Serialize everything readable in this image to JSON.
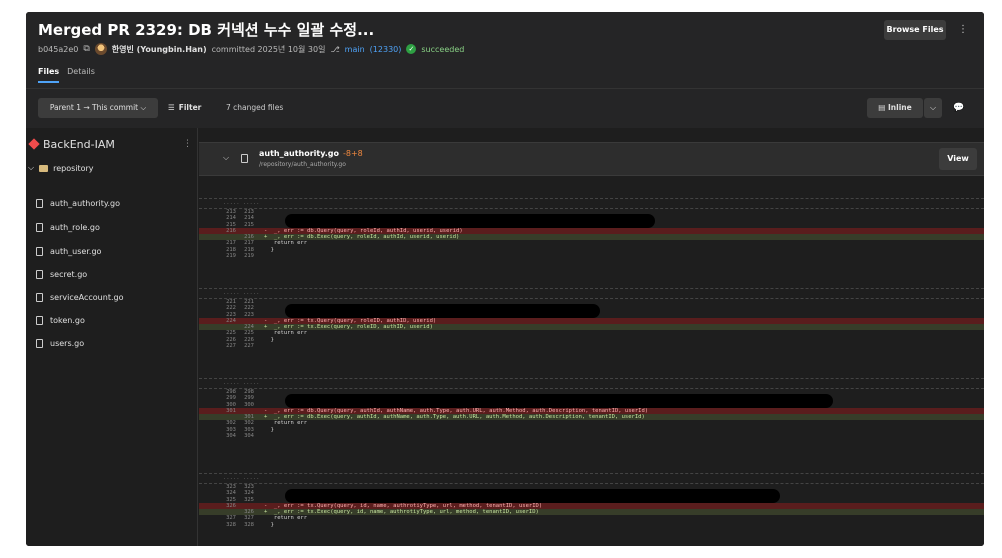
{
  "header": {
    "title": "Merged PR 2329: DB 커넥션 누수 일괄 수정...",
    "commit_hash": "b045a2e0",
    "author": "한영빈 (Youngbin.Han)",
    "committed_text": "committed 2025년 10월 30일",
    "branch": "main",
    "branch_pr": "(12330)",
    "status": "succeeded",
    "browse_files": "Browse Files",
    "more": "⋮"
  },
  "tabs": [
    {
      "label": "Files",
      "active": true
    },
    {
      "label": "Details",
      "active": false
    }
  ],
  "toolbar": {
    "parent_dropdown": "Parent 1 → This commit",
    "filter_label": "Filter",
    "changed_files": "7 changed files",
    "view_mode": "Inline"
  },
  "sidebar": {
    "repo_name": "BackEnd-IAM",
    "folder": "repository",
    "files": [
      "auth_authority.go",
      "auth_role.go",
      "auth_user.go",
      "secret.go",
      "serviceAccount.go",
      "token.go",
      "users.go"
    ]
  },
  "diff": {
    "file_name": "auth_authority.go",
    "file_stat": "-8+8",
    "file_path": "/repository/auth_authority.go",
    "view_button": "View",
    "separator_text": ".....  .....",
    "hunks": [
      {
        "lines": [
          {
            "type": "ctx",
            "a": "213",
            "b": "213",
            "code": ""
          },
          {
            "type": "ctx",
            "a": "214",
            "b": "214",
            "code": ""
          },
          {
            "type": "ctx",
            "a": "215",
            "b": "215",
            "code": ""
          },
          {
            "type": "del",
            "a": "216",
            "b": "",
            "code": "-  _, err := db.Query(query, roleId, authId, userid, userid)"
          },
          {
            "type": "add",
            "a": "",
            "b": "216",
            "code": "+  _, err := db.Exec(query, roleId, authId, userid, userid)"
          },
          {
            "type": "ctx",
            "a": "217",
            "b": "217",
            "code": "   return err"
          },
          {
            "type": "ctx",
            "a": "218",
            "b": "218",
            "code": "  }"
          },
          {
            "type": "ctx",
            "a": "219",
            "b": "219",
            "code": ""
          }
        ]
      },
      {
        "lines": [
          {
            "type": "ctx",
            "a": "221",
            "b": "221",
            "code": ""
          },
          {
            "type": "ctx",
            "a": "222",
            "b": "222",
            "code": ""
          },
          {
            "type": "ctx",
            "a": "223",
            "b": "223",
            "code": ""
          },
          {
            "type": "del",
            "a": "224",
            "b": "",
            "code": "-  _, err := tx.Query(query, roleID, authID, userid)"
          },
          {
            "type": "add",
            "a": "",
            "b": "224",
            "code": "+  _, err := tx.Exec(query, roleID, authID, userid)"
          },
          {
            "type": "ctx",
            "a": "225",
            "b": "225",
            "code": "   return err"
          },
          {
            "type": "ctx",
            "a": "226",
            "b": "226",
            "code": "  }"
          },
          {
            "type": "ctx",
            "a": "227",
            "b": "227",
            "code": ""
          }
        ]
      },
      {
        "lines": [
          {
            "type": "ctx",
            "a": "298",
            "b": "298",
            "code": ""
          },
          {
            "type": "ctx",
            "a": "299",
            "b": "299",
            "code": ""
          },
          {
            "type": "ctx",
            "a": "300",
            "b": "300",
            "code": ""
          },
          {
            "type": "del",
            "a": "301",
            "b": "",
            "code": "-  _, err := db.Query(query, authId, authName, auth.Type, auth.URL, auth.Method, auth.Description, tenantID, userId)"
          },
          {
            "type": "add",
            "a": "",
            "b": "301",
            "code": "+  _, err := db.Exec(query, authId, authName, auth.Type, auth.URL, auth.Method, auth.Description, tenantID, userId)"
          },
          {
            "type": "ctx",
            "a": "302",
            "b": "302",
            "code": "   return err"
          },
          {
            "type": "ctx",
            "a": "303",
            "b": "303",
            "code": "  }"
          },
          {
            "type": "ctx",
            "a": "304",
            "b": "304",
            "code": ""
          }
        ]
      },
      {
        "lines": [
          {
            "type": "ctx",
            "a": "323",
            "b": "323",
            "code": ""
          },
          {
            "type": "ctx",
            "a": "324",
            "b": "324",
            "code": ""
          },
          {
            "type": "ctx",
            "a": "325",
            "b": "325",
            "code": ""
          },
          {
            "type": "del",
            "a": "326",
            "b": "",
            "code": "-  _, err := tx.Query(query, id, name, authrotiyType, url, method, tenantID, userID)"
          },
          {
            "type": "add",
            "a": "",
            "b": "326",
            "code": "+  _, err := tx.Exec(query, id, name, authrotiyType, url, method, tenantID, userID)"
          },
          {
            "type": "ctx",
            "a": "327",
            "b": "327",
            "code": "   return err"
          },
          {
            "type": "ctx",
            "a": "328",
            "b": "328",
            "code": "  }"
          }
        ]
      }
    ]
  }
}
